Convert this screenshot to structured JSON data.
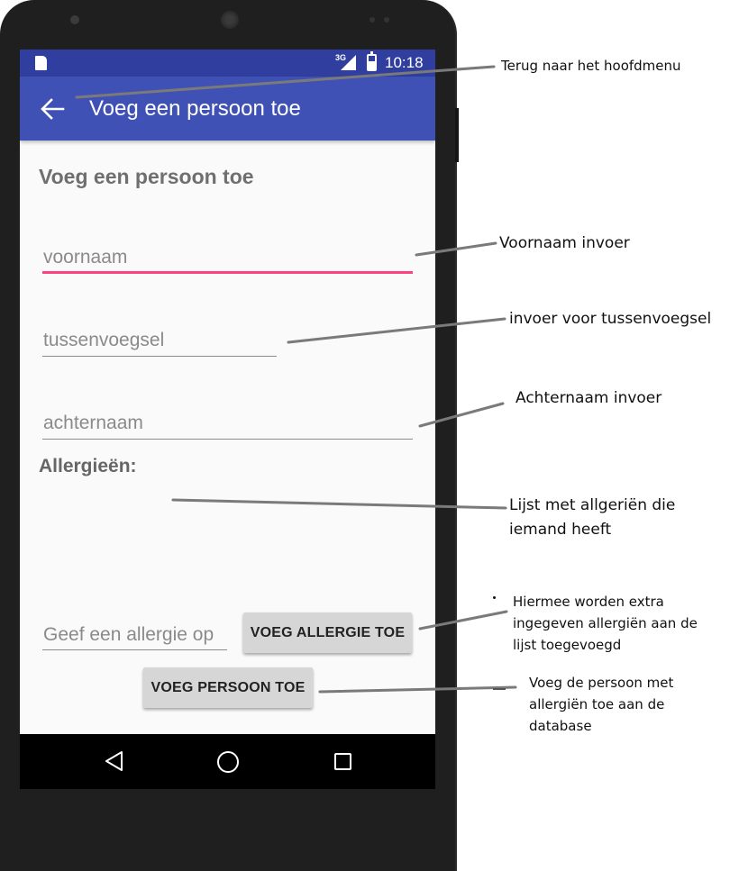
{
  "status_bar": {
    "network": "3G",
    "time": "10:18"
  },
  "toolbar": {
    "title": "Voeg een persoon toe"
  },
  "form": {
    "heading": "Voeg een persoon toe",
    "voornaam_placeholder": "voornaam",
    "tussenvoegsel_placeholder": "tussenvoegsel",
    "achternaam_placeholder": "achternaam",
    "allergies_label": "Allergieën:",
    "allergie_placeholder": "Geef een allergie op",
    "add_allergy_button": "VOEG ALLERGIE TOE",
    "add_person_button": "VOEG PERSOON TOE"
  },
  "nav_bar": {
    "icons": [
      "back-triangle-icon",
      "home-circle-icon",
      "recents-square-icon"
    ]
  },
  "annotations": {
    "back": "Terug naar het hoofdmenu",
    "voornaam": "Voornaam invoer",
    "tussenvoegsel": "invoer voor tussenvoegsel",
    "achternaam": "Achternaam invoer",
    "allergy_list": "Lijst met allgeriën die iemand heeft",
    "add_allergy": "Hiermee worden extra ingegeven allergiën aan de lijst toegevoegd",
    "add_person": "Voeg de persoon met allergiën toe aan de database"
  },
  "colors": {
    "status_bar": "#303f9f",
    "toolbar": "#3f51b5",
    "focus_accent": "#ff4081",
    "button": "#d6d6d6",
    "annotation_line": "#777777"
  }
}
